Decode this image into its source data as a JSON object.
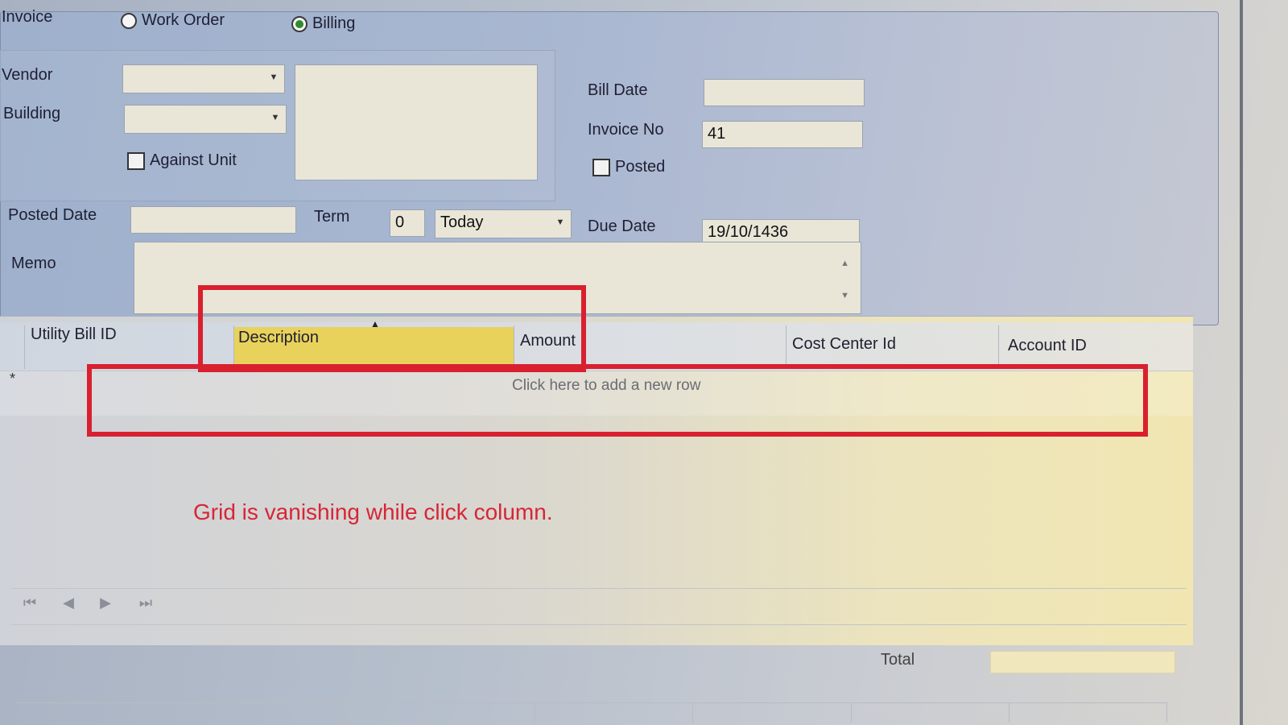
{
  "invoice_type": {
    "label": "Invoice",
    "options": [
      {
        "label": "Work Order",
        "selected": false
      },
      {
        "label": "Billing",
        "selected": true
      }
    ]
  },
  "form": {
    "vendor_label": "Vendor",
    "vendor_value": "",
    "building_label": "Building",
    "building_value": "",
    "against_unit_label": "Against Unit",
    "against_unit_checked": false,
    "bill_date_label": "Bill Date",
    "bill_date_value": "",
    "invoice_no_label": "Invoice No",
    "invoice_no_value": "41",
    "posted_label": "Posted",
    "posted_checked": false,
    "posted_date_label": "Posted Date",
    "posted_date_value": "",
    "term_label": "Term",
    "term_value": "0",
    "term_option": "Today",
    "due_date_label": "Due Date",
    "due_date_value": "19/10/1436",
    "memo_label": "Memo",
    "memo_value": ""
  },
  "grid": {
    "columns": [
      "Utility Bill ID",
      "Description",
      "Amount",
      "Cost Center Id",
      "Account ID"
    ],
    "new_row_indicator": "*",
    "new_row_text": "Click here to add a new row"
  },
  "annotation": "Grid is vanishing while click column.",
  "footer": {
    "total_label": "Total",
    "total_value": ""
  },
  "colors": {
    "annotation_red": "#d9202f",
    "selected_column": "#e8d25c",
    "radio_selected": "#2e8b2e"
  }
}
